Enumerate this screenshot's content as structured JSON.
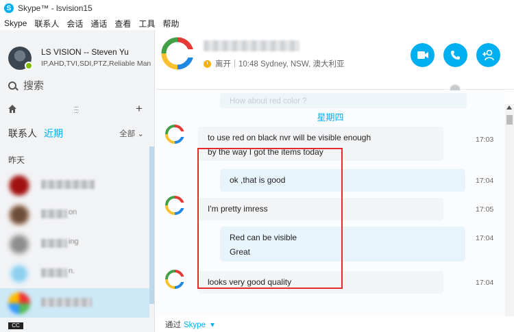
{
  "window": {
    "title": "Skype™ - lsvision15"
  },
  "menu": [
    "Skype",
    "联系人",
    "会话",
    "通话",
    "查看",
    "工具",
    "帮助"
  ],
  "profile": {
    "name": "LS VISION -- Steven Yu",
    "mood": "IP,AHD,TVI,SDI,PTZ,Reliable Man...",
    "presence_color": "#7fba00"
  },
  "sidebar": {
    "search_placeholder": "搜索",
    "tabs": {
      "contacts": "联系人",
      "recent": "近期"
    },
    "filter": "全部",
    "section_label": "昨天",
    "contact_suffixes": [
      "",
      "on",
      "ing",
      "n.",
      ""
    ],
    "badge": "CC"
  },
  "chat": {
    "status": "离开",
    "local_time": "10:48 Sydney, NSW, 澳大利亚",
    "faded_message": "How about red color ?",
    "day_label": "星期四",
    "messages": [
      {
        "text": "to use red on black nvr will be visible enough",
        "time": "17:03"
      },
      {
        "text": "by the way I got the items today"
      },
      {
        "text": "ok ,that is good",
        "time": "17:04"
      },
      {
        "text": "I'm pretty imress",
        "time": "17:05"
      },
      {
        "text": "Red can be visible",
        "time": "17:04"
      },
      {
        "text": "Great"
      },
      {
        "text": "looks very good quality",
        "time": "17:04"
      }
    ],
    "via_label": "通过",
    "via_service": "Skype"
  },
  "colors": {
    "accent": "#00aff0",
    "highlight_box": "#e32b2b",
    "status_away": "#f5b400"
  }
}
